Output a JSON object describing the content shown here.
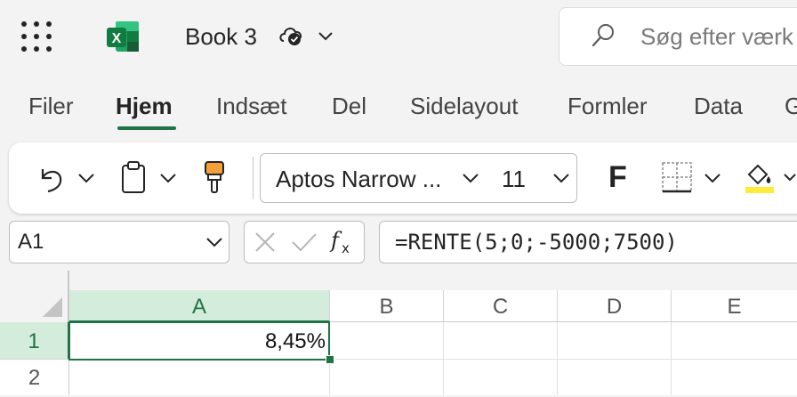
{
  "app": {
    "document_title": "Book 3",
    "brand_color": "#217346",
    "icons": [
      "app-launcher-icon",
      "excel-logo-icon",
      "cloud-saved-icon",
      "chevron-down-icon",
      "search-icon"
    ]
  },
  "search": {
    "placeholder": "Søg efter værk"
  },
  "menu": {
    "tabs": [
      {
        "label": "Filer",
        "active": false
      },
      {
        "label": "Hjem",
        "active": true
      },
      {
        "label": "Indsæt",
        "active": false
      },
      {
        "label": "Del",
        "active": false
      },
      {
        "label": "Sidelayout",
        "active": false
      },
      {
        "label": "Formler",
        "active": false
      },
      {
        "label": "Data",
        "active": false
      },
      {
        "label": "G",
        "active": false
      }
    ]
  },
  "ribbon": {
    "font_name": "Aptos Narrow ...",
    "font_size": "11",
    "bold_label": "F",
    "icons": [
      "undo-icon",
      "clipboard-icon",
      "format-painter-icon",
      "borders-icon",
      "fill-color-icon"
    ]
  },
  "formula_bar": {
    "name_box": "A1",
    "formula": "=RENTE(5;0;-5000;7500)",
    "icons": [
      "cancel-icon",
      "enter-check-icon",
      "insert-function-icon"
    ]
  },
  "sheet": {
    "columns": [
      "A",
      "B",
      "C",
      "D",
      "E"
    ],
    "rows": [
      "1",
      "2"
    ],
    "selected_cell": "A1",
    "cells": {
      "A1": "8,45%"
    }
  }
}
